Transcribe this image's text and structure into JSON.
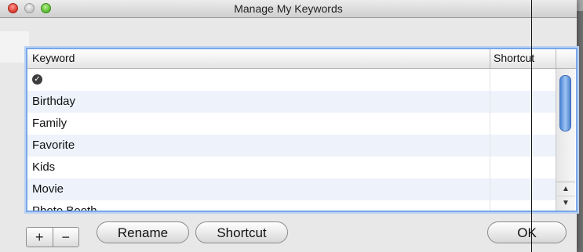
{
  "window": {
    "title": "Manage My Keywords"
  },
  "table": {
    "columns": [
      "Keyword",
      "Shortcut"
    ],
    "rows": [
      {
        "keyword": "",
        "icon": "checkmark-circle-icon"
      },
      {
        "keyword": "Birthday"
      },
      {
        "keyword": "Family"
      },
      {
        "keyword": "Favorite"
      },
      {
        "keyword": "Kids"
      },
      {
        "keyword": "Movie"
      },
      {
        "keyword": "Photo Booth"
      }
    ]
  },
  "buttons": {
    "add": "+",
    "remove": "−",
    "rename": "Rename",
    "shortcut": "Shortcut",
    "ok": "OK"
  },
  "colors": {
    "focus_ring": "#7aa7e6",
    "alt_row": "#edf2fb",
    "scroll_thumb": "#4c86d8"
  }
}
